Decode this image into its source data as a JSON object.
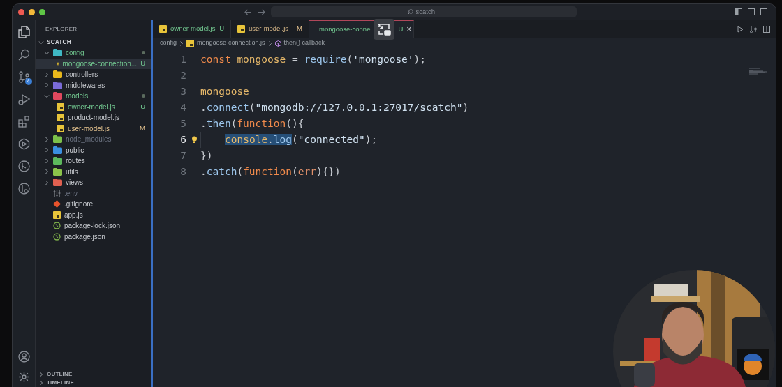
{
  "search": {
    "placeholder": "scatch"
  },
  "explorer": {
    "title": "EXPLORER",
    "more": "···",
    "root": "SCATCH",
    "tree": [
      {
        "kind": "folder",
        "name": "config",
        "expanded": true,
        "untracked": true,
        "modified": false,
        "ignored": false,
        "dot": true,
        "color": "#3fb8c4",
        "children": [
          {
            "kind": "js",
            "name": "mongoose-connection...",
            "untracked": true,
            "modified": false,
            "ignored": false,
            "badge": "U",
            "selected": true
          }
        ]
      },
      {
        "kind": "folder",
        "name": "controllers",
        "expanded": false,
        "untracked": false,
        "modified": false,
        "ignored": false,
        "dot": false,
        "color": "#e8b71c"
      },
      {
        "kind": "folder",
        "name": "middlewares",
        "expanded": false,
        "untracked": false,
        "modified": false,
        "ignored": false,
        "dot": false,
        "color": "#7a6bd8"
      },
      {
        "kind": "folder",
        "name": "models",
        "expanded": true,
        "untracked": true,
        "modified": false,
        "ignored": false,
        "dot": true,
        "color": "#e0485e",
        "children": [
          {
            "kind": "js",
            "name": "owner-model.js",
            "untracked": true,
            "modified": false,
            "ignored": false,
            "badge": "U",
            "selected": false
          },
          {
            "kind": "js",
            "name": "product-model.js",
            "untracked": false,
            "modified": false,
            "ignored": false,
            "selected": false
          },
          {
            "kind": "js",
            "name": "user-model.js",
            "untracked": false,
            "modified": true,
            "ignored": false,
            "badge": "M",
            "selected": false
          }
        ]
      },
      {
        "kind": "folder",
        "name": "node_modules",
        "expanded": false,
        "untracked": false,
        "modified": false,
        "ignored": true,
        "dot": false,
        "color": "#7cc04a"
      },
      {
        "kind": "folder",
        "name": "public",
        "expanded": false,
        "untracked": false,
        "modified": false,
        "ignored": false,
        "dot": false,
        "color": "#3a8fe0"
      },
      {
        "kind": "folder",
        "name": "routes",
        "expanded": false,
        "untracked": false,
        "modified": false,
        "ignored": false,
        "dot": false,
        "color": "#5cb85c"
      },
      {
        "kind": "folder",
        "name": "utils",
        "expanded": false,
        "untracked": false,
        "modified": false,
        "ignored": false,
        "dot": false,
        "color": "#8bc34a"
      },
      {
        "kind": "folder",
        "name": "views",
        "expanded": false,
        "untracked": false,
        "modified": false,
        "ignored": false,
        "dot": false,
        "color": "#e06050"
      },
      {
        "kind": "env",
        "name": ".env",
        "untracked": false,
        "modified": false,
        "ignored": true,
        "selected": false
      },
      {
        "kind": "git",
        "name": ".gitignore",
        "untracked": false,
        "modified": false,
        "ignored": false,
        "selected": false
      },
      {
        "kind": "js",
        "name": "app.js",
        "untracked": false,
        "modified": false,
        "ignored": false,
        "selected": false
      },
      {
        "kind": "npm",
        "name": "package-lock.json",
        "untracked": false,
        "modified": false,
        "ignored": false,
        "selected": false
      },
      {
        "kind": "npm",
        "name": "package.json",
        "untracked": false,
        "modified": false,
        "ignored": false,
        "selected": false
      }
    ],
    "sections": [
      {
        "label": "OUTLINE",
        "expanded": false
      },
      {
        "label": "TIMELINE",
        "expanded": false
      }
    ]
  },
  "source_control_count": "4",
  "tabs": [
    {
      "name": "owner-model.js",
      "badge": "U",
      "untracked": true,
      "modified": false,
      "selected": false
    },
    {
      "name": "user-model.js",
      "badge": "M",
      "untracked": false,
      "modified": true,
      "selected": false
    },
    {
      "name": "mongoose-conne",
      "badge": "U",
      "untracked": true,
      "modified": false,
      "selected": true,
      "close": "×"
    }
  ],
  "breadcrumb": [
    {
      "kind": "folder",
      "label": "config"
    },
    {
      "kind": "js",
      "label": "mongoose-connection.js"
    },
    {
      "kind": "symbol",
      "label": "then() callback"
    }
  ],
  "editor": {
    "lines": [
      {
        "number": "1",
        "active": false,
        "tokens": [
          {
            "kind": "keyword",
            "s": "const "
          },
          {
            "kind": "var",
            "s": "mongoose"
          },
          {
            "kind": "plain",
            "s": " = "
          },
          {
            "kind": "func",
            "s": "require"
          },
          {
            "kind": "plain",
            "s": "("
          },
          {
            "kind": "string",
            "s": "'mongoose'"
          },
          {
            "kind": "plain",
            "s": ");"
          }
        ]
      },
      {
        "number": "2",
        "active": false
      },
      {
        "number": "3",
        "active": false,
        "tokens": [
          {
            "kind": "var",
            "s": "mongoose"
          }
        ]
      },
      {
        "number": "4",
        "active": false,
        "tokens": [
          {
            "kind": "plain",
            "s": "."
          },
          {
            "kind": "func",
            "s": "connect"
          },
          {
            "kind": "plain",
            "s": "("
          },
          {
            "kind": "string",
            "s": "\"mongodb://127.0.0.1:27017/scatch\""
          },
          {
            "kind": "plain",
            "s": ")"
          }
        ]
      },
      {
        "number": "5",
        "active": false,
        "tokens": [
          {
            "kind": "plain",
            "s": "."
          },
          {
            "kind": "func",
            "s": "then"
          },
          {
            "kind": "plain",
            "s": "("
          },
          {
            "kind": "keyword",
            "s": "function"
          },
          {
            "kind": "plain",
            "s": "(){"
          }
        ]
      },
      {
        "number": "6",
        "active": true,
        "indent": true,
        "bulb": true,
        "tokens": [
          {
            "kind": "var",
            "s": "console",
            "selected": true
          },
          {
            "kind": "plain",
            "s": ".",
            "selected": true
          },
          {
            "kind": "func",
            "s": "log",
            "selected": true
          },
          {
            "kind": "plain",
            "s": "(",
            "selected": false
          },
          {
            "kind": "string",
            "s": "\"connected\"",
            "selected": false
          },
          {
            "kind": "plain",
            "s": ");",
            "selected": false
          }
        ]
      },
      {
        "number": "7",
        "active": false,
        "tokens": [
          {
            "kind": "plain",
            "s": "})"
          }
        ]
      },
      {
        "number": "8",
        "active": false,
        "tokens": [
          {
            "kind": "plain",
            "s": "."
          },
          {
            "kind": "func",
            "s": "catch"
          },
          {
            "kind": "plain",
            "s": "("
          },
          {
            "kind": "keyword",
            "s": "function"
          },
          {
            "kind": "plain",
            "s": "("
          },
          {
            "kind": "param",
            "s": "err"
          },
          {
            "kind": "plain",
            "s": "){})"
          }
        ]
      }
    ]
  }
}
